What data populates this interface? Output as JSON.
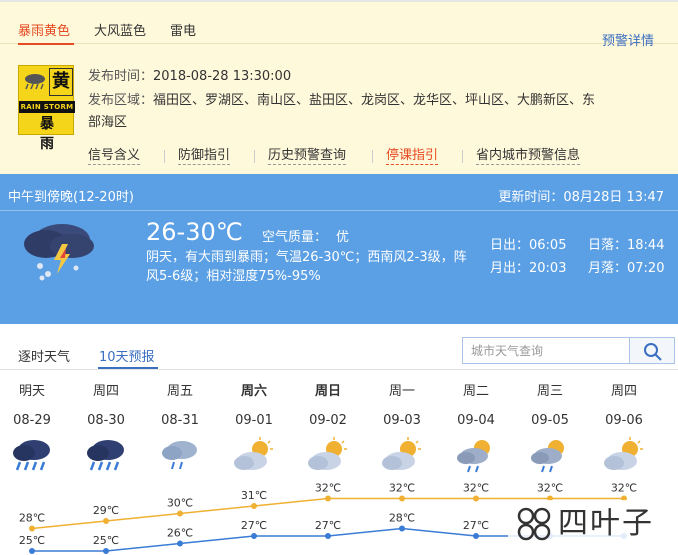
{
  "alert": {
    "tabs": [
      "暴雨黄色",
      "大风蓝色",
      "雷电"
    ],
    "detail_link": "预警详情",
    "icon": {
      "top_char": "黄",
      "banner": "RAIN STORM",
      "bottom": "暴 雨"
    },
    "publish_label": "发布时间：",
    "publish_time": "2018-08-28 13:30:00",
    "area_label": "发布区域：",
    "area_line1": "福田区、罗湖区、南山区、盐田区、龙岗区、龙华区、坪山区、大鹏新区、东",
    "area_line2": "部海区",
    "links": [
      "信号含义",
      "防御指引",
      "历史预警查询",
      "停课指引",
      "省内城市预警信息"
    ]
  },
  "current": {
    "period": "中午到傍晚(12-20时)",
    "update": "更新时间：08月28日 13:47",
    "temp": "26-30℃",
    "aqi_label": "空气质量：",
    "aqi_value": "优",
    "desc": "阴天，有大雨到暴雨；气温26-30℃；西南风2-3级，阵风5-6级；相对湿度75%-95%",
    "sunrise": "日出：06:05",
    "sunset": "日落：18:44",
    "moonrise": "月出：20:03",
    "moonset": "月落：07:20",
    "icon": "thunderstorm-icon"
  },
  "forecast": {
    "tabs": [
      "逐时天气",
      "10天预报"
    ],
    "search_placeholder": "城市天气查询",
    "days": [
      {
        "name": "明天",
        "date": "08-29",
        "bold": false,
        "icon": "heavy-rain-icon"
      },
      {
        "name": "周四",
        "date": "08-30",
        "bold": false,
        "icon": "heavy-rain-icon"
      },
      {
        "name": "周五",
        "date": "08-31",
        "bold": false,
        "icon": "rain-icon"
      },
      {
        "name": "周六",
        "date": "09-01",
        "bold": true,
        "icon": "partly-cloudy-icon"
      },
      {
        "name": "周日",
        "date": "09-02",
        "bold": true,
        "icon": "partly-cloudy-icon"
      },
      {
        "name": "周一",
        "date": "09-03",
        "bold": false,
        "icon": "partly-cloudy-icon"
      },
      {
        "name": "周二",
        "date": "09-04",
        "bold": false,
        "icon": "partly-cloudy-shower-icon"
      },
      {
        "name": "周三",
        "date": "09-05",
        "bold": false,
        "icon": "partly-cloudy-shower-icon"
      },
      {
        "name": "周四",
        "date": "09-06",
        "bold": false,
        "icon": "partly-cloudy-icon"
      }
    ],
    "highs": [
      "28℃",
      "29℃",
      "30℃",
      "31℃",
      "32℃",
      "32℃",
      "32℃",
      "32℃",
      "32℃"
    ],
    "lows": [
      "25℃",
      "25℃",
      "26℃",
      "27℃",
      "27℃",
      "28℃",
      "27℃",
      "",
      ""
    ],
    "high_values": [
      28,
      29,
      30,
      31,
      32,
      32,
      32,
      32,
      32
    ],
    "low_values": [
      25,
      25,
      26,
      27,
      27,
      28,
      27,
      27,
      27
    ]
  },
  "watermark": {
    "text": "四叶子"
  },
  "colors": {
    "accent": "#e54a21",
    "link": "#3a6ec0",
    "card": "#5b9fe4",
    "high_line": "#f0b032",
    "low_line": "#3a7bd5"
  }
}
